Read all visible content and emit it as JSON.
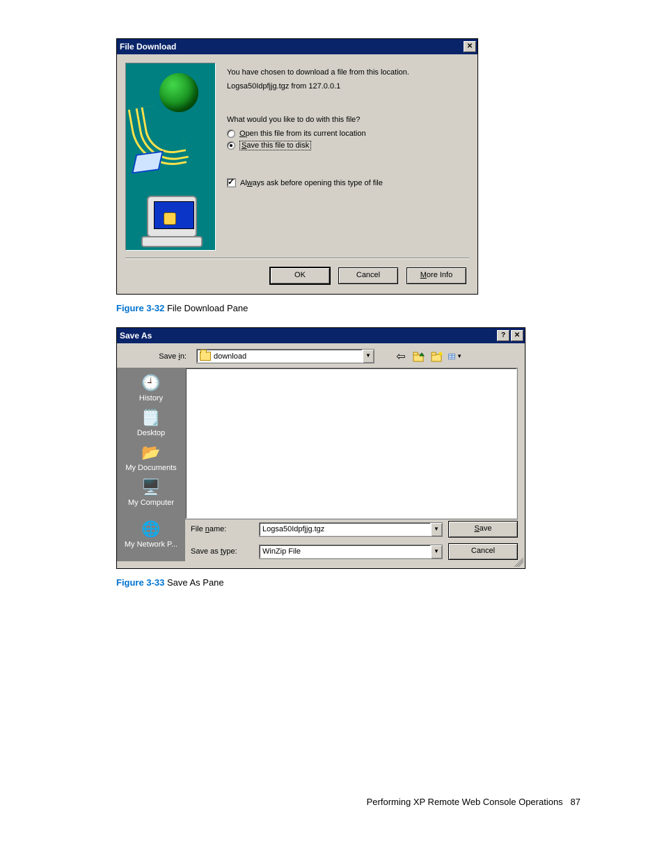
{
  "dlg1": {
    "title": "File Download",
    "line1": "You have chosen to download a file from this location.",
    "line2": "Logsa50Idpfjjg.tgz from 127.0.0.1",
    "prompt": "What would you like to do with this file?",
    "opt_open_pre": "O",
    "opt_open": "pen this file from its current location",
    "opt_save_pre": "S",
    "opt_save": "ave this file to disk",
    "check_pre": "Al",
    "check_ul": "w",
    "check_post": "ays ask before opening this type of file",
    "btn_ok": "OK",
    "btn_cancel": "Cancel",
    "btn_more_pre": "M",
    "btn_more_post": "ore Info"
  },
  "caption1": {
    "label": "Figure 3-32",
    "text": " File Download Pane"
  },
  "dlg2": {
    "title": "Save As",
    "savein_label_pre": "Save ",
    "savein_label_ul": "i",
    "savein_label_post": "n:",
    "savein_value": "download",
    "places": {
      "history": "History",
      "desktop": "Desktop",
      "mydocs": "My Documents",
      "mycomp": "My Computer",
      "mynet": "My Network P..."
    },
    "filename_label_pre": "File ",
    "filename_label_ul": "n",
    "filename_label_post": "ame:",
    "filename_value": "Logsa50Idpfjjg.tgz",
    "saveastype_label_pre": "Save as ",
    "saveastype_label_ul": "t",
    "saveastype_label_post": "ype:",
    "saveastype_value": "WinZip File",
    "btn_save_pre": "S",
    "btn_save_post": "ave",
    "btn_cancel": "Cancel"
  },
  "caption2": {
    "label": "Figure 3-33",
    "text": " Save As Pane"
  },
  "footer": {
    "text": "Performing XP Remote Web Console Operations",
    "page": "87"
  }
}
